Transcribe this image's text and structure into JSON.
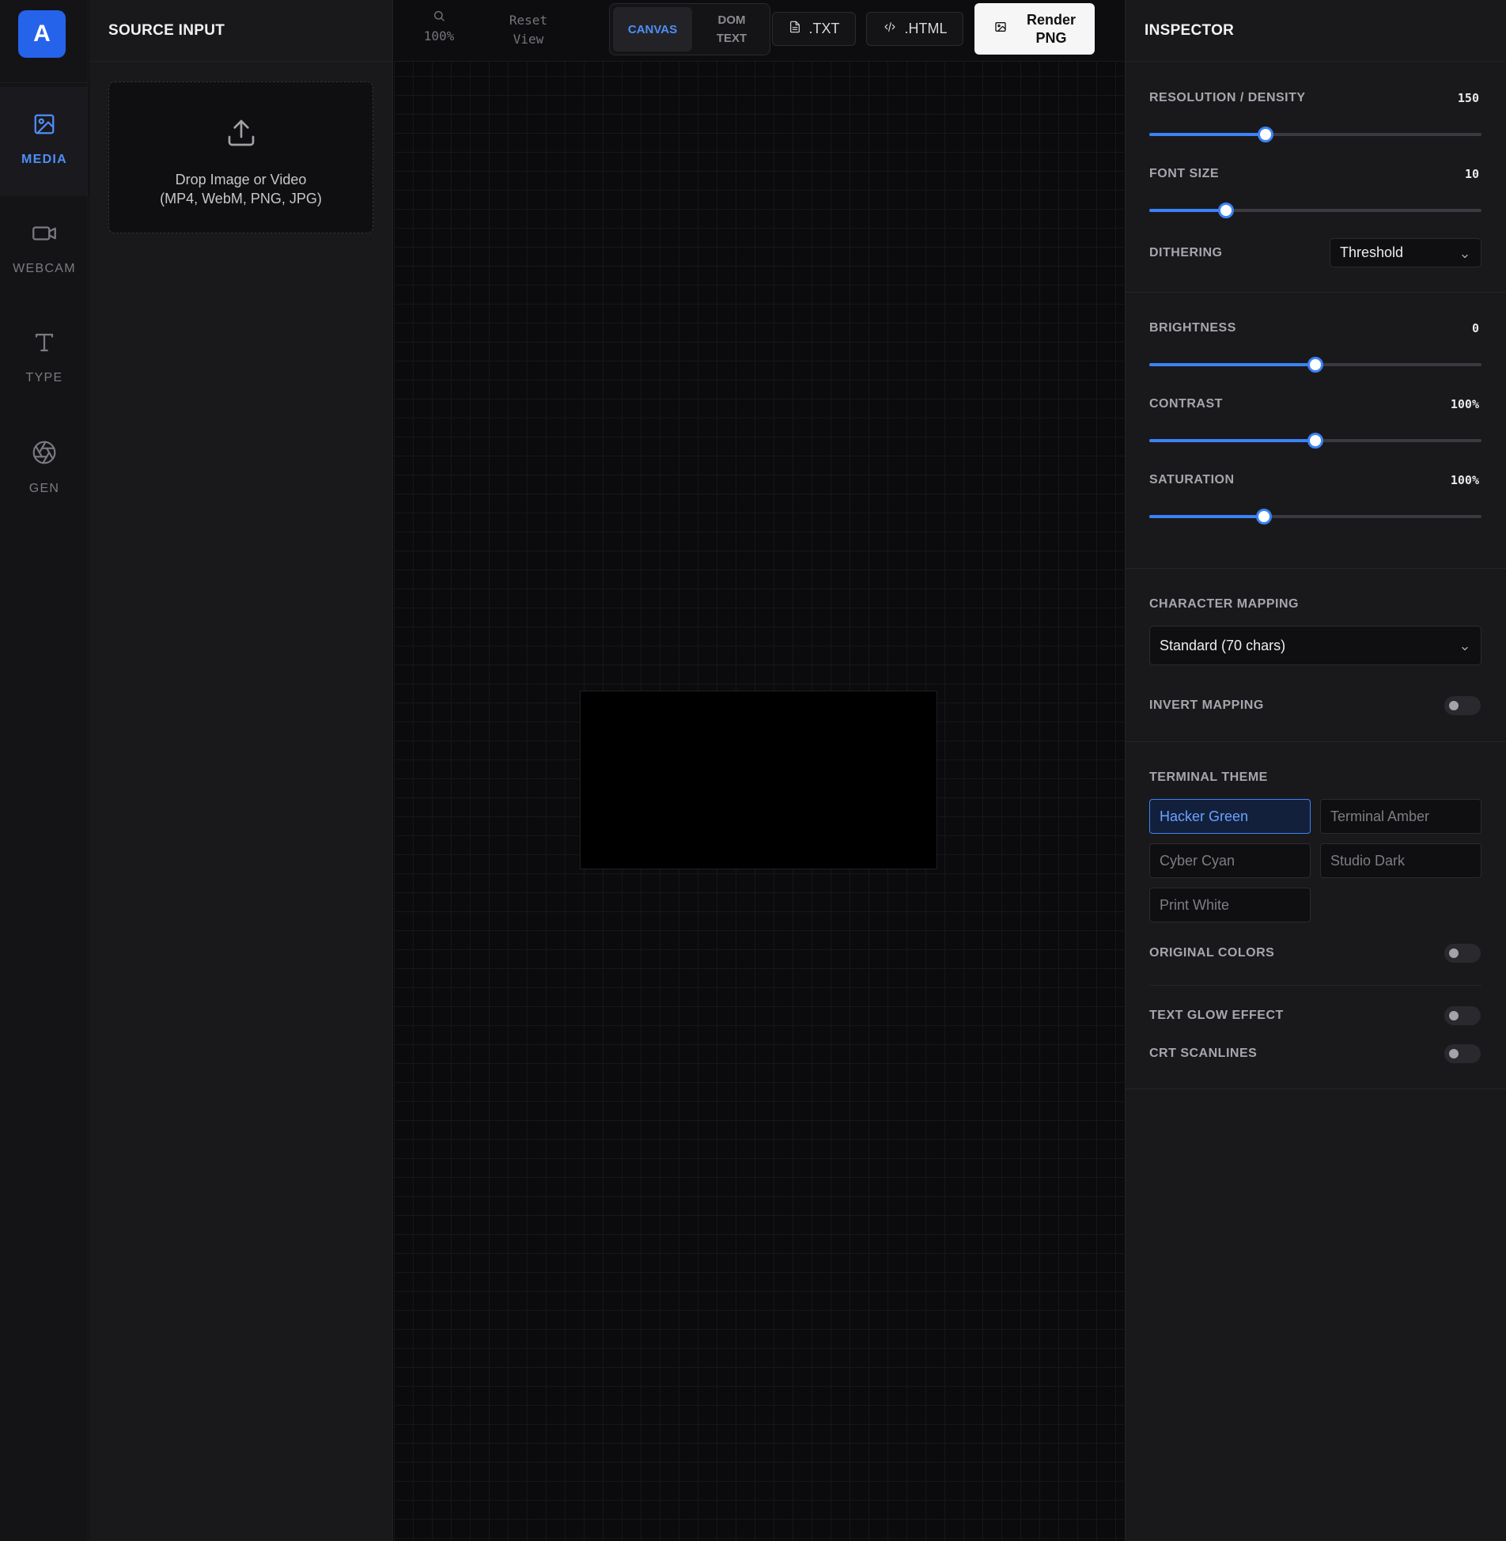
{
  "app": {
    "logo_letter": "A",
    "accent_color": "#2563eb"
  },
  "rail": {
    "items": [
      {
        "label": "MEDIA",
        "icon": "image-icon",
        "active": true
      },
      {
        "label": "WEBCAM",
        "icon": "video-camera-icon",
        "active": false
      },
      {
        "label": "TYPE",
        "icon": "text-type-icon",
        "active": false
      },
      {
        "label": "GEN",
        "icon": "aperture-icon",
        "active": false
      }
    ]
  },
  "source": {
    "title": "SOURCE INPUT",
    "dropzone": {
      "icon": "upload-icon",
      "line1": "Drop Image or Video",
      "line2": "(MP4, WebM, PNG, JPG)"
    }
  },
  "toolbar": {
    "zoom_icon": "search-icon",
    "zoom": "100%",
    "reset_line1": "Reset",
    "reset_line2": "View",
    "view_modes": [
      {
        "line1": "CANVAS",
        "line2": "",
        "active": true
      },
      {
        "line1": "DOM",
        "line2": "TEXT",
        "active": false
      }
    ],
    "export_txt": {
      "label": ".TXT",
      "icon": "file-icon"
    },
    "export_html": {
      "label": ".HTML",
      "icon": "code-icon"
    },
    "render": {
      "line1": "Render",
      "line2": "PNG",
      "icon": "image-icon"
    }
  },
  "inspector": {
    "title": "INSPECTOR",
    "resolution": {
      "label": "RESOLUTION / DENSITY",
      "value": "150",
      "fraction": 0.35
    },
    "font_size": {
      "label": "FONT SIZE",
      "value": "10",
      "fraction": 0.23
    },
    "dithering": {
      "label": "DITHERING",
      "selected": "Threshold"
    },
    "brightness": {
      "label": "BRIGHTNESS",
      "value": "0",
      "fraction": 0.5
    },
    "contrast": {
      "label": "CONTRAST",
      "value": "100%",
      "fraction": 0.5
    },
    "saturation": {
      "label": "SATURATION",
      "value": "100%",
      "fraction": 0.345
    },
    "character_mapping": {
      "label": "CHARACTER MAPPING",
      "selected": "Standard (70 chars)"
    },
    "invert_mapping": {
      "label": "INVERT MAPPING",
      "on": false
    },
    "terminal_theme": {
      "label": "TERMINAL THEME",
      "options": [
        {
          "name": "Hacker Green",
          "active": true
        },
        {
          "name": "Terminal Amber",
          "active": false
        },
        {
          "name": "Cyber Cyan",
          "active": false
        },
        {
          "name": "Studio Dark",
          "active": false
        },
        {
          "name": "Print White",
          "active": false
        }
      ]
    },
    "original_colors": {
      "label": "ORIGINAL COLORS",
      "on": false
    },
    "text_glow": {
      "label": "TEXT GLOW EFFECT",
      "on": false
    },
    "crt_scanlines": {
      "label": "CRT SCANLINES",
      "on": false
    }
  }
}
